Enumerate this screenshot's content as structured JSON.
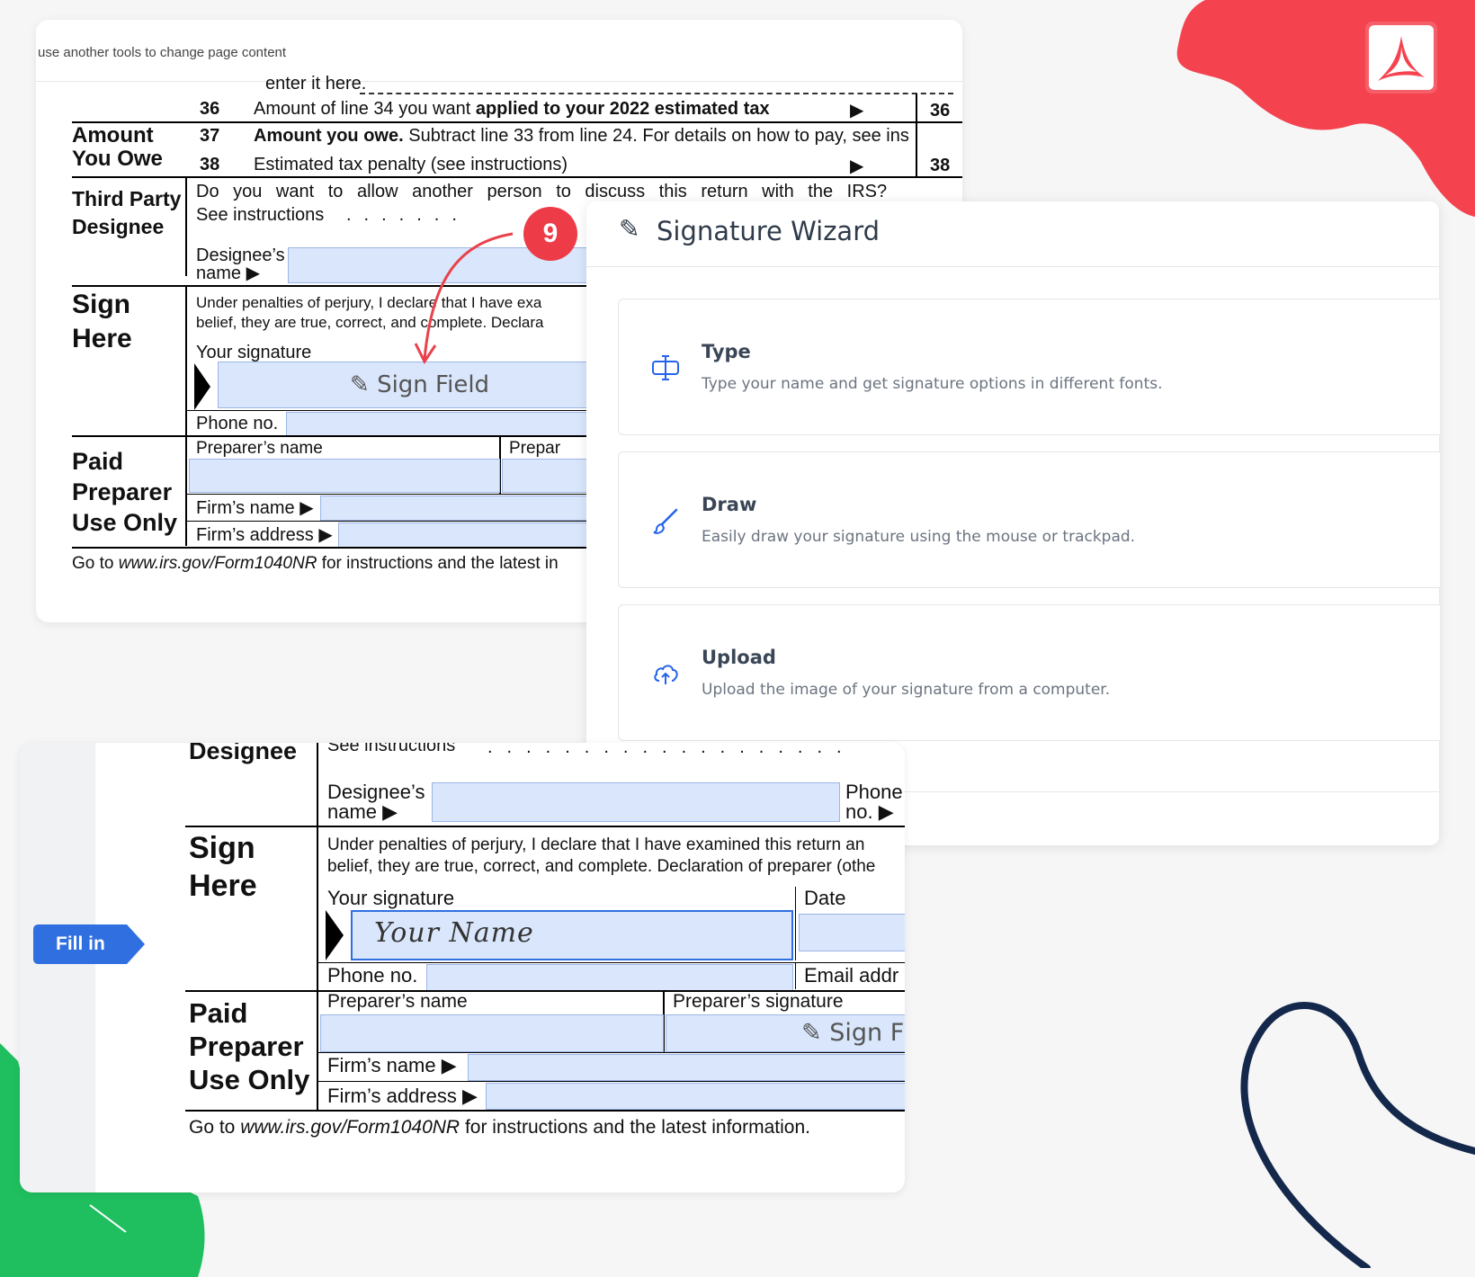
{
  "toolbar": {
    "hint": "use another tools to change page content"
  },
  "form_top": {
    "line_enter": "enter it here.",
    "line36_num": "36",
    "line36_text_a": "Amount of line 34 you want ",
    "line36_text_b": "applied to your 2022 estimated tax",
    "line36_box": "36",
    "section_amount_owe_1": "Amount",
    "section_amount_owe_2": "You Owe",
    "line37_num": "37",
    "line37_text_a": "Amount you owe.",
    "line37_text_b": " Subtract line 33 from line 24. For details on how to pay, see ins",
    "line38_num": "38",
    "line38_text": "Estimated tax penalty (see instructions)",
    "line38_box": "38",
    "section_third_party_1": "Third Party",
    "section_third_party_2": "Designee",
    "designee_question": "Do you want to allow another person to discuss this return with the IRS?",
    "see_instructions": "See instructions",
    "designee_name_1": "Designee’s",
    "designee_name_2": "name",
    "section_sign_1": "Sign",
    "section_sign_2": "Here",
    "perjury_1": "Under penalties of perjury, I declare that I have exa",
    "perjury_2": "belief, they are true, correct, and complete. Declara",
    "your_signature": "Your signature",
    "sign_field": "Sign Field",
    "phone_no": "Phone no.",
    "section_paid_1": "Paid",
    "section_paid_2": "Preparer",
    "section_paid_3": "Use Only",
    "preparers_name": "Preparer’s name",
    "preparer_cut": "Prepar",
    "firms_name": "Firm’s name",
    "firms_address": "Firm’s address",
    "footer_a": "Go to ",
    "footer_link": "www.irs.gov/Form1040NR",
    "footer_b": " for instructions and the latest in"
  },
  "step_badge": "9",
  "wizard": {
    "title": "Signature Wizard",
    "options": [
      {
        "title": "Type",
        "desc": "Type your name and get signature options in different fonts.",
        "icon": "text-cursor-icon"
      },
      {
        "title": "Draw",
        "desc": "Easily draw your signature using the mouse or trackpad.",
        "icon": "brush-icon"
      },
      {
        "title": "Upload",
        "desc": "Upload the image of your signature from a computer.",
        "icon": "cloud-upload-icon"
      }
    ]
  },
  "form_bottom": {
    "designee": "Designee",
    "see_instructions": "See instructions",
    "designee_name_1": "Designee’s",
    "designee_name_2": "name",
    "phone_cut_1": "Phone",
    "phone_cut_2": "no.",
    "sign": "Sign",
    "here": "Here",
    "perjury_1": "Under penalties of perjury, I declare that I have examined this return an",
    "perjury_2": "belief, they are true, correct, and complete. Declaration of preparer (othe",
    "your_signature": "Your signature",
    "date": "Date",
    "signature_value": "Your Name",
    "phone_no": "Phone no.",
    "email_cut": "Email addr",
    "paid": "Paid",
    "preparer": "Preparer",
    "use_only": "Use Only",
    "preparers_name": "Preparer’s name",
    "preparers_signature": "Preparer’s signature",
    "sign_cut": "Sign F",
    "firms_name": "Firm’s name",
    "firms_address": "Firm’s address",
    "footer_a": "Go to ",
    "footer_link": "www.irs.gov/Form1040NR",
    "footer_b": " for instructions and the latest information."
  },
  "fill_in_tag": "Fill in",
  "colors": {
    "accent_red": "#f4434f",
    "accent_green": "#1fbf5f",
    "navy": "#14284b",
    "field_blue": "#d9e6fb",
    "tag_blue": "#2f6fe0"
  }
}
